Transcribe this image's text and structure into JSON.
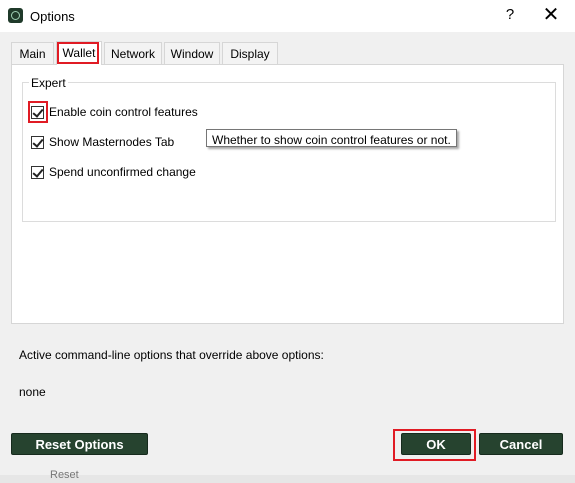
{
  "window": {
    "title": "Options",
    "help_label": "?",
    "close_label": "✕",
    "icon": "coin-app-icon"
  },
  "tabs": [
    {
      "label": "Main"
    },
    {
      "label": "Wallet"
    },
    {
      "label": "Network"
    },
    {
      "label": "Window"
    },
    {
      "label": "Display"
    }
  ],
  "active_tab": "Wallet",
  "expert": {
    "title": "Expert",
    "options": [
      {
        "label": "Enable coin control features",
        "checked": true
      },
      {
        "label": "Show Masternodes Tab",
        "checked": true
      },
      {
        "label": "Spend unconfirmed change",
        "checked": true
      }
    ]
  },
  "tooltip": "Whether to show coin control features or not.",
  "overrides": {
    "label": "Active command-line options that override above options:",
    "value": "none"
  },
  "buttons": {
    "reset": "Reset Options",
    "ok": "OK",
    "cancel": "Cancel"
  },
  "bottom_clip_text": "Reset",
  "colors": {
    "highlight": "#e01b24",
    "button_bg": "#26432f"
  }
}
